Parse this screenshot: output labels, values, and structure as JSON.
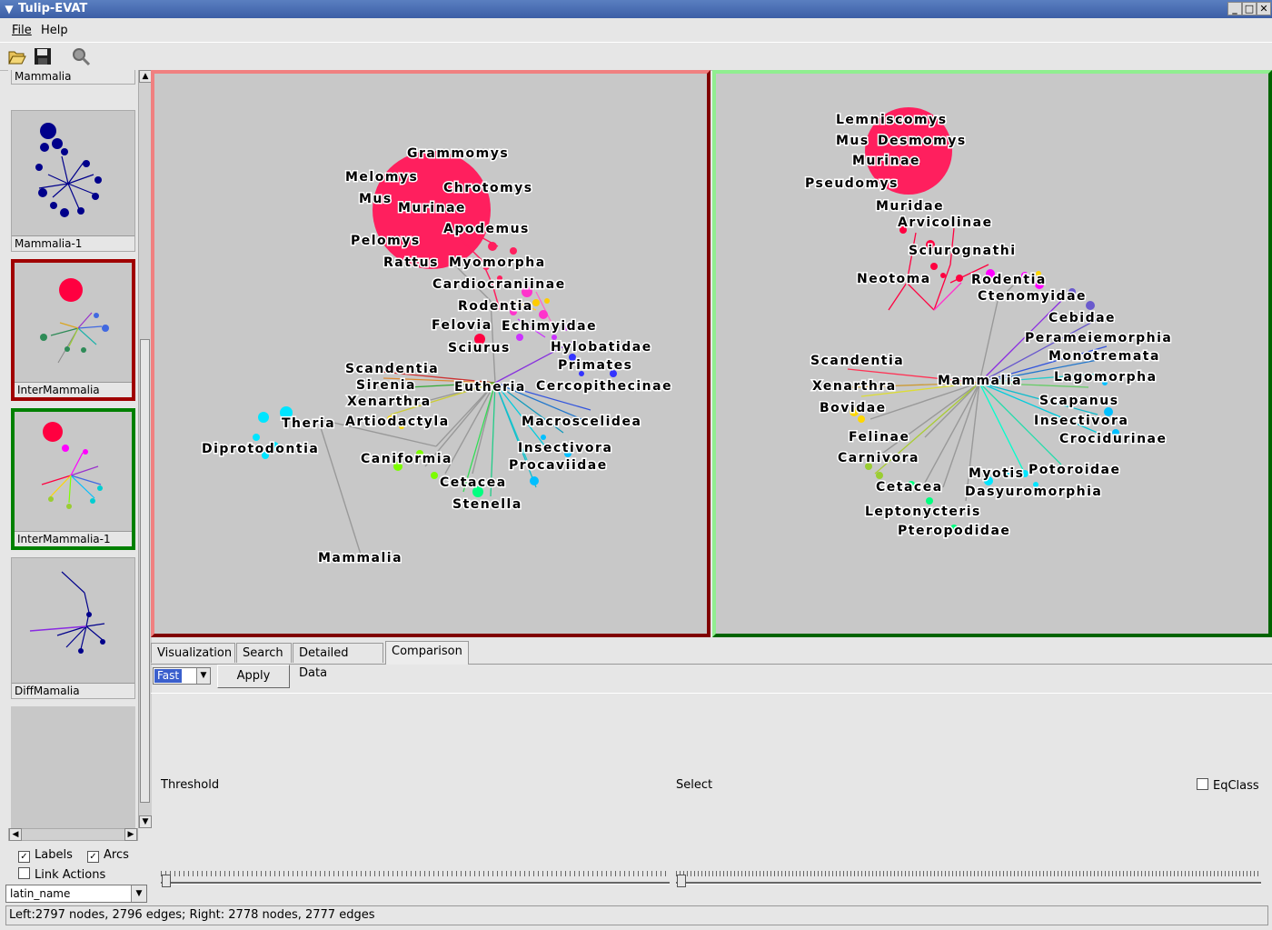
{
  "window": {
    "title": "Tulip-EVAT"
  },
  "menu": {
    "file": "File",
    "help": "Help"
  },
  "toolbar": {
    "open_icon": "folder-open-icon",
    "save_icon": "floppy-disk-icon",
    "search_icon": "magnifier-icon"
  },
  "sidebar": {
    "thumbnails": [
      {
        "label": "Mammalia"
      },
      {
        "label": "Mammalia-1"
      },
      {
        "label": "InterMammalia"
      },
      {
        "label": "InterMammalia-1"
      },
      {
        "label": "DiffMamalia"
      }
    ],
    "labels_option": "Labels",
    "arcs_option": "Arcs",
    "link_actions_option": "Link Actions",
    "property_select": "latin_name"
  },
  "left_view": {
    "labels": [
      "Grammomys",
      "Melomys",
      "Chrotomys",
      "Mus",
      "Murinae",
      "Apodemus",
      "Pelomys",
      "Rattus",
      "Myomorpha",
      "Cardiocraniinae",
      "Rodentia",
      "Felovia",
      "Echimyidae",
      "Sciurus",
      "Hylobatidae",
      "Primates",
      "Scandentia",
      "Sirenia",
      "Eutheria",
      "Cercopithecinae",
      "Xenarthra",
      "Theria",
      "Artiodactyla",
      "Macroscelidea",
      "Diprotodontia",
      "Insectivora",
      "Caniformia",
      "Procaviidae",
      "Cetacea",
      "Stenella",
      "Mammalia"
    ]
  },
  "right_view": {
    "labels": [
      "Lemniscomys",
      "Mus",
      "Desmomys",
      "Murinae",
      "Pseudomys",
      "Muridae",
      "Arvicolinae",
      "Sciurognathi",
      "Neotoma",
      "Rodentia",
      "Ctenomyidae",
      "Cebidae",
      "Perameiemorphia",
      "Scandentia",
      "Monotremata",
      "Mammalia",
      "Xenarthra",
      "Lagomorpha",
      "Bovidae",
      "Scapanus",
      "Insectivora",
      "Felinae",
      "Crocidurinae",
      "Carnivora",
      "Potoroidae",
      "Myotis",
      "Cetacea",
      "Dasyuromorphia",
      "Leptonycteris",
      "Pteropodidae"
    ]
  },
  "tabs": [
    "Visualization",
    "Search",
    "Detailed Data",
    "Comparison"
  ],
  "comparison": {
    "mode": "Fast",
    "apply_label": "Apply",
    "threshold_label": "Threshold",
    "select_label": "Select",
    "eqclass_label": "EqClass"
  },
  "status": "Left:2797 nodes, 2796 edges; Right: 2778 nodes, 2777 edges"
}
